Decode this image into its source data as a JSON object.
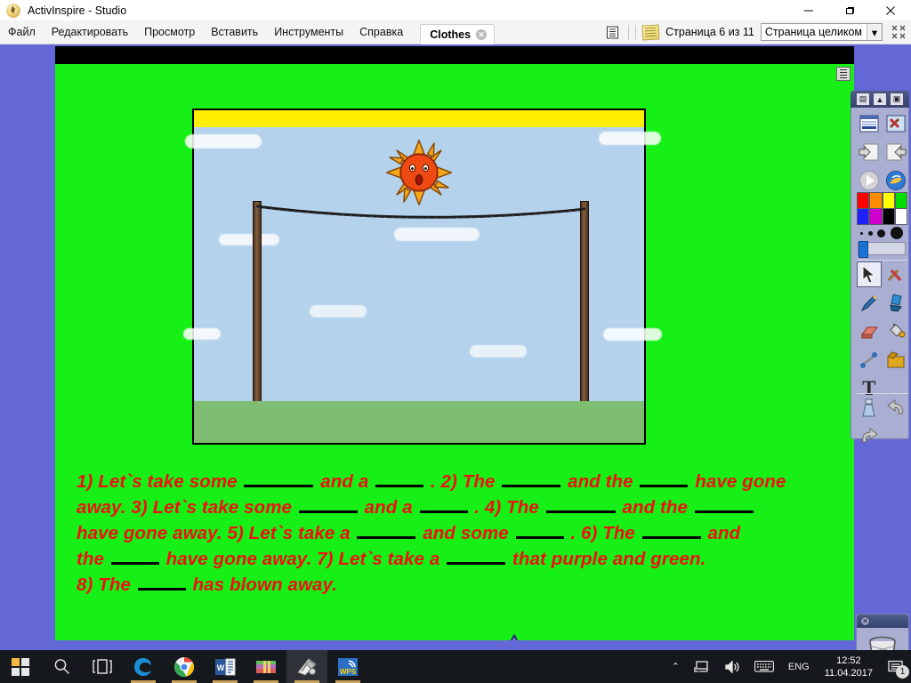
{
  "window": {
    "title": "ActivInspire - Studio",
    "app_icon": "activinspire-icon",
    "minimize_label": "—",
    "maximize_label": "❐",
    "close_label": "✕"
  },
  "menubar": {
    "items": [
      {
        "label": "Файл",
        "name": "menu-file"
      },
      {
        "label": "Редактировать",
        "name": "menu-edit"
      },
      {
        "label": "Просмотр",
        "name": "menu-view"
      },
      {
        "label": "Вставить",
        "name": "menu-insert"
      },
      {
        "label": "Инструменты",
        "name": "menu-tools"
      },
      {
        "label": "Справка",
        "name": "menu-help"
      }
    ],
    "tab": {
      "label": "Clothes",
      "close": "✕"
    },
    "page_indicator": "Страница 6 из 11",
    "zoom_value": "Страница целиком",
    "zoom_arrow": "▾",
    "notes_icon": "sticky-note-icon",
    "pagesorter_icon": "page-sorter-icon",
    "fullscreen_icon": "fullscreen-icon"
  },
  "flipchart": {
    "background_color": "#16f016",
    "picture": {
      "name": "clothesline-illustration",
      "sky_color": "#b4d2ec",
      "ground_color": "#7ebd72",
      "banner_color": "#ffee00",
      "pole_color": "#82603f",
      "sun": {
        "name": "sun-face",
        "body_color": "#ef4a13",
        "ray_color": "#f6a81c"
      }
    },
    "text_color": "#ee1111",
    "lines": [
      [
        {
          "t": "1) Let`s take some "
        },
        {
          "blank": "lg"
        },
        {
          "t": " and  a "
        },
        {
          "blank": "sm"
        },
        {
          "t": " . 2) The "
        },
        {
          "blank": "md"
        },
        {
          "t": "  and  the "
        },
        {
          "blank": "sm"
        },
        {
          "t": " have gone"
        }
      ],
      [
        {
          "t": " away. 3) Let`s take some "
        },
        {
          "blank": "md"
        },
        {
          "t": " and a "
        },
        {
          "blank": "sm"
        },
        {
          "t": " .  4) The "
        },
        {
          "blank": "lg"
        },
        {
          "t": " and the "
        },
        {
          "blank": "md"
        }
      ],
      [
        {
          "t": "have gone away. 5) Let`s take a "
        },
        {
          "blank": "md"
        },
        {
          "t": " and some "
        },
        {
          "blank": "sm"
        },
        {
          "t": " .  6)  The "
        },
        {
          "blank": "md"
        },
        {
          "t": " and"
        }
      ],
      [
        {
          "t": "the "
        },
        {
          "blank": "sm"
        },
        {
          "t": " have gone away. 7)  Let`s take a "
        },
        {
          "blank": "md"
        },
        {
          "t": " that purple and green."
        }
      ],
      [
        {
          "t": "8) The "
        },
        {
          "blank": "sm"
        },
        {
          "t": " has blown away."
        }
      ]
    ],
    "nav_prev": "previous-page-button",
    "nav_next": "next-page-button",
    "star": {
      "name": "star-shape",
      "fill": "#7f8fd6",
      "stroke": "#2a2a6e"
    }
  },
  "toolbox": {
    "header_buttons": [
      {
        "name": "toolbox-menu-icon",
        "glyph": "▤"
      },
      {
        "name": "toolbox-collapse-icon",
        "glyph": "▲"
      },
      {
        "name": "toolbox-lock-icon",
        "glyph": "▣"
      }
    ],
    "rows": [
      [
        {
          "name": "pages-browser-icon",
          "glyph": "☰"
        },
        {
          "name": "tool-settings-icon",
          "glyph": "⚒"
        }
      ],
      [
        {
          "name": "previous-page-icon",
          "glyph": "←"
        },
        {
          "name": "next-page-icon",
          "glyph": "→"
        }
      ],
      [
        {
          "name": "play-icon",
          "glyph": "▶"
        },
        {
          "name": "resource-browser-icon",
          "glyph": "◉"
        }
      ]
    ],
    "palette_row1": [
      "#ff0000",
      "#ff8c00",
      "#ffff00",
      "#00e000"
    ],
    "palette_row2": [
      "#2020ff",
      "#d000d0",
      "#000000",
      "#ffffff"
    ],
    "pen_sizes": [
      3,
      5,
      9,
      14
    ],
    "slider_value": 12,
    "tools": [
      [
        {
          "name": "select-tool-icon",
          "glyph": "➤",
          "selected": true
        },
        {
          "name": "tools-icon",
          "glyph": "⚒"
        }
      ],
      [
        {
          "name": "pen-tool-icon",
          "glyph": "✒"
        },
        {
          "name": "highlighter-tool-icon",
          "glyph": "▐"
        }
      ],
      [
        {
          "name": "eraser-tool-icon",
          "glyph": "▰"
        },
        {
          "name": "fill-tool-icon",
          "glyph": "⛃"
        }
      ],
      [
        {
          "name": "shape-tool-icon",
          "glyph": "⬚"
        },
        {
          "name": "media-tool-icon",
          "glyph": "⬛"
        }
      ],
      [
        {
          "name": "text-tool-icon",
          "glyph": "T"
        },
        {
          "name": "spacer",
          "glyph": ""
        }
      ],
      [
        {
          "name": "clear-tool-icon",
          "glyph": "⚗"
        },
        {
          "name": "undo-icon",
          "glyph": "↶"
        }
      ],
      [
        {
          "name": "redo-icon",
          "glyph": "↷"
        },
        {
          "name": "spacer",
          "glyph": ""
        }
      ]
    ]
  },
  "bin": {
    "name": "recycle-bin",
    "close": "✕",
    "icon": "trash-can-icon"
  },
  "taskbar": {
    "items": [
      {
        "name": "start-button",
        "icon": "windows-logo-icon"
      },
      {
        "name": "search-button",
        "icon": "search-icon"
      },
      {
        "name": "task-view-button",
        "icon": "task-view-icon"
      },
      {
        "name": "taskbar-edge",
        "icon": "edge-icon",
        "running": false
      },
      {
        "name": "taskbar-chrome",
        "icon": "chrome-icon",
        "running": true
      },
      {
        "name": "taskbar-word",
        "icon": "word-icon",
        "running": true
      },
      {
        "name": "taskbar-winrar",
        "icon": "winrar-icon",
        "running": true
      },
      {
        "name": "taskbar-activinspire",
        "icon": "activinspire-icon",
        "running": true,
        "active": true
      },
      {
        "name": "taskbar-wps",
        "icon": "wps-icon",
        "running": true
      }
    ],
    "tray": {
      "chevron": "⌃",
      "network_icon": "network-icon",
      "volume_icon": "volume-icon",
      "keyboard_icon": "keyboard-icon",
      "language": "ENG",
      "time": "12:52",
      "date": "11.04.2017",
      "notification_icon": "notifications-icon",
      "notification_count": "1"
    }
  }
}
